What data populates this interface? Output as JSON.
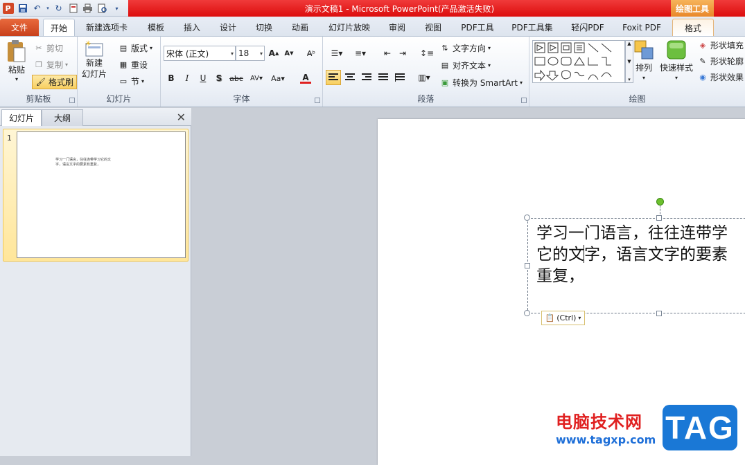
{
  "titlebar": {
    "title": "演示文稿1 - Microsoft PowerPoint(产品激活失败)",
    "contextual_tab_group": "绘图工具",
    "app_icon": "P"
  },
  "tabs": [
    "文件",
    "开始",
    "新建选项卡",
    "模板",
    "插入",
    "设计",
    "切换",
    "动画",
    "幻灯片放映",
    "审阅",
    "视图",
    "PDF工具",
    "PDF工具集",
    "轻闪PDF",
    "Foxit PDF",
    "格式"
  ],
  "ribbon": {
    "clipboard": {
      "label": "剪贴板",
      "paste": "粘贴",
      "cut": "剪切",
      "copy": "复制",
      "format_painter": "格式刷"
    },
    "slides": {
      "label": "幻灯片",
      "new_slide_1": "新建",
      "new_slide_2": "幻灯片",
      "layout": "版式",
      "reset": "重设",
      "section": "节"
    },
    "font": {
      "label": "字体",
      "font_name": "宋体 (正文)",
      "font_size": "18"
    },
    "paragraph": {
      "label": "段落",
      "text_direction": "文字方向",
      "align_text": "对齐文本",
      "convert_smartart": "转换为 SmartArt"
    },
    "drawing": {
      "label": "绘图",
      "arrange": "排列",
      "quick_styles": "快速样式",
      "shape_fill": "形状填充",
      "shape_outline": "形状轮廓",
      "shape_effects": "形状效果"
    }
  },
  "leftpane": {
    "tab_slides": "幻灯片",
    "tab_outline": "大纲",
    "close": "✕",
    "slide_number": "1",
    "thumb_text": "学习一门语言，往往连带学习它的文字，语言文字的要素有重复，"
  },
  "slide": {
    "text": "学习一门语言，往往连带学\n它的文字，语言文字的要素\n重复，",
    "paste_options": "(Ctrl)"
  },
  "watermark": {
    "site_name": "电脑技术网",
    "url": "www.tagxp.com",
    "logo": "TAG"
  }
}
